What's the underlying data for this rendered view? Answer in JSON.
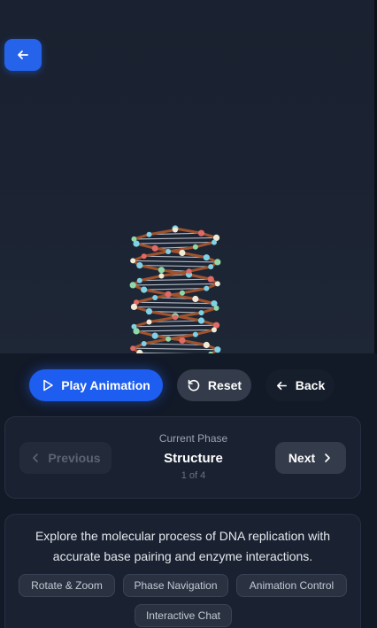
{
  "viewer": {
    "back_icon": "arrow-left-icon",
    "accent": "#2563eb"
  },
  "controls": {
    "play_label": "Play Animation",
    "reset_label": "Reset",
    "back_label": "Back"
  },
  "phase": {
    "previous_label": "Previous",
    "next_label": "Next",
    "current_label": "Current Phase",
    "name": "Structure",
    "position": "1 of 4"
  },
  "info": {
    "description": "Explore the molecular process of DNA replication with accurate base pairing and enzyme interactions.",
    "tags": [
      "Rotate & Zoom",
      "Phase Navigation",
      "Animation Control",
      "Interactive Chat"
    ]
  }
}
